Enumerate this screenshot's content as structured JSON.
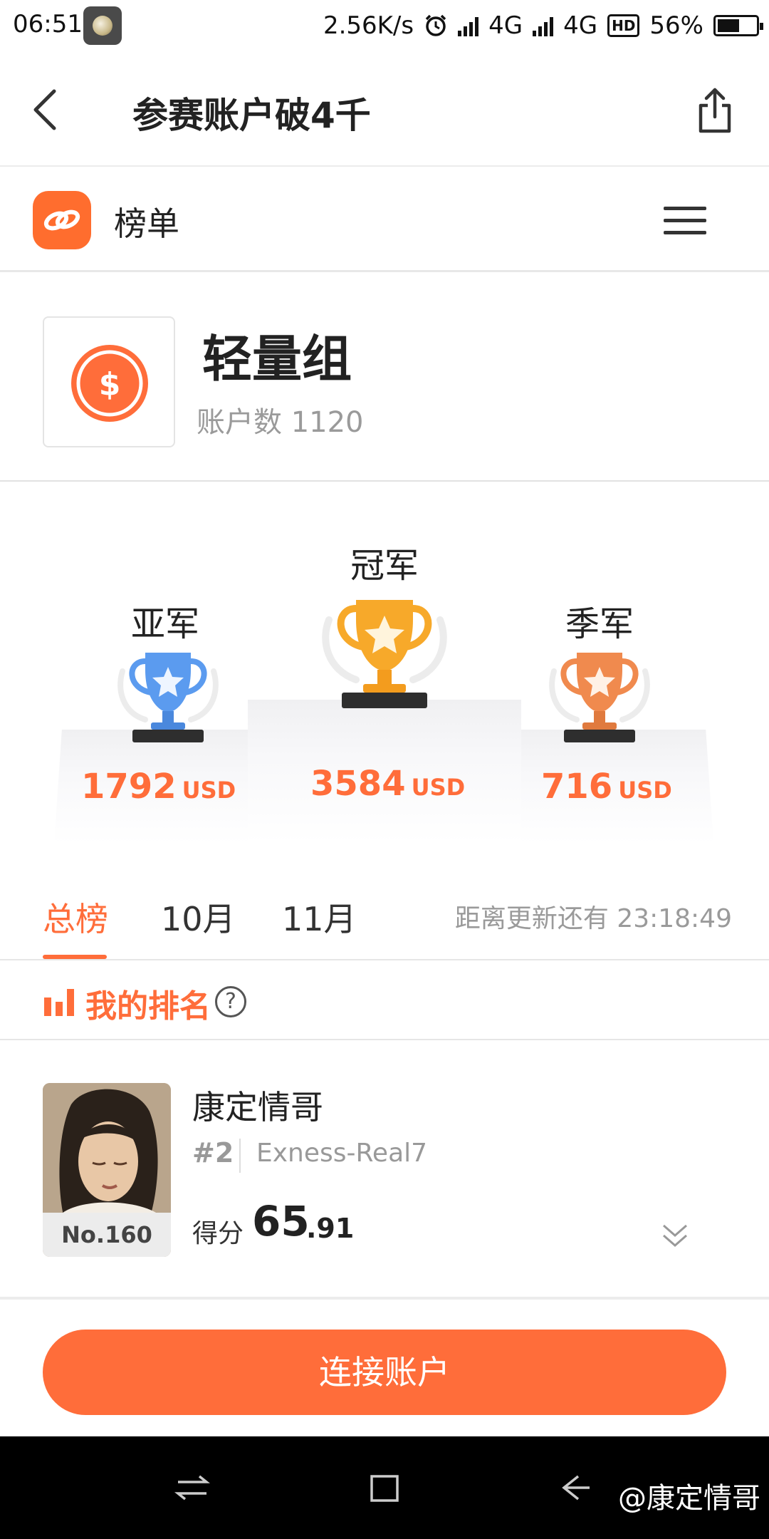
{
  "status_bar": {
    "time": "06:51",
    "speed": "2.56K/s",
    "net1": "4G",
    "net2": "4G",
    "hd": "HD",
    "battery": "56%"
  },
  "header": {
    "title": "参赛账户破4千"
  },
  "rank_header": {
    "title": "榜单"
  },
  "group": {
    "name": "轻量组",
    "accounts_label": "账户数 1120"
  },
  "podium": {
    "first": {
      "label": "冠军",
      "amount": "3584",
      "unit": "USD"
    },
    "second": {
      "label": "亚军",
      "amount": "1792",
      "unit": "USD"
    },
    "third": {
      "label": "季军",
      "amount": "716",
      "unit": "USD"
    }
  },
  "tabs": {
    "items": [
      {
        "label": "总榜",
        "active": true
      },
      {
        "label": "10月",
        "active": false
      },
      {
        "label": "11月",
        "active": false
      }
    ],
    "countdown": "距离更新还有 23:18:49"
  },
  "my_rank": {
    "title": "我的排名",
    "help": "?"
  },
  "user": {
    "name": "康定情哥",
    "position": "#2",
    "account": "Exness-Real7",
    "rank_badge": "No.160",
    "score_label": "得分",
    "score_int": "65",
    "score_dec": ".91"
  },
  "actions": {
    "connect": "连接账户"
  },
  "watermark": "@康定情哥",
  "colors": {
    "accent": "#ff6d3a",
    "gold": "#f7a92a",
    "silver": "#5b9bef",
    "bronze": "#f08a4e"
  }
}
